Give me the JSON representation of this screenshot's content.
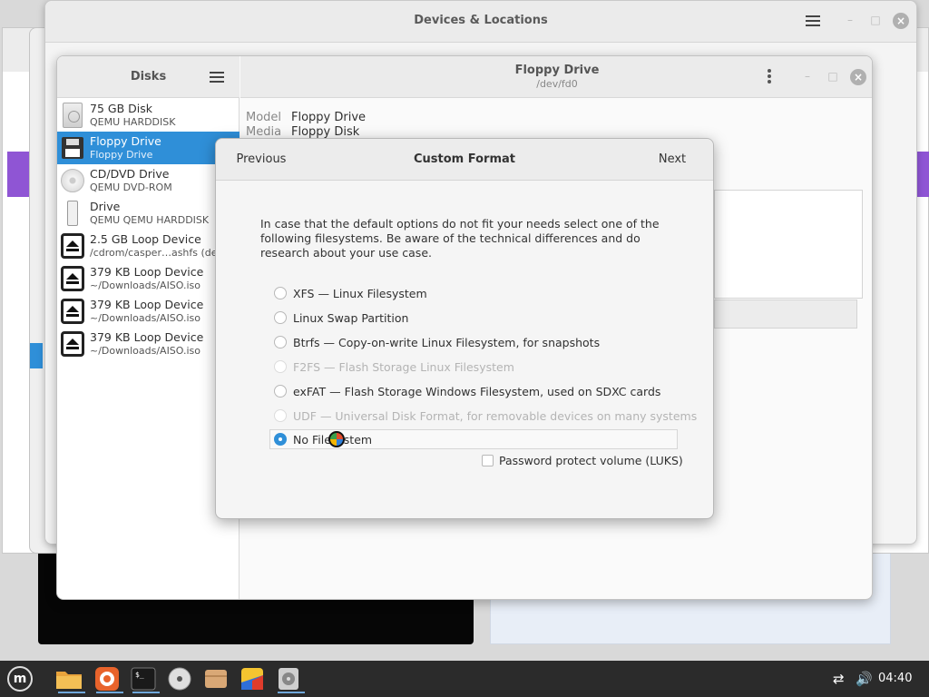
{
  "settings_window": {
    "title": "Devices & Locations"
  },
  "disks_window": {
    "sidebar_title": "Disks",
    "drive_title": "Floppy Drive",
    "drive_path": "/dev/fd0",
    "info": {
      "model_label": "Model",
      "model_value": "Floppy Drive",
      "media_label": "Media",
      "media_value": "Floppy Disk"
    },
    "disks": [
      {
        "name": "75 GB Disk",
        "sub": "QEMU HARDDISK",
        "icon": "harddisk-icon"
      },
      {
        "name": "Floppy Drive",
        "sub": "Floppy Drive",
        "icon": "floppy-icon",
        "selected": true
      },
      {
        "name": "CD/DVD Drive",
        "sub": "QEMU DVD-ROM",
        "icon": "optical-disc-icon"
      },
      {
        "name": "Drive",
        "sub": "QEMU QEMU HARDDISK",
        "icon": "usb-drive-icon"
      },
      {
        "name": "2.5 GB Loop Device",
        "sub": "/cdrom/casper…ashfs (dele",
        "icon": "eject-icon"
      },
      {
        "name": "379 KB Loop Device",
        "sub": "~/Downloads/AISO.iso",
        "icon": "eject-icon"
      },
      {
        "name": "379 KB Loop Device",
        "sub": "~/Downloads/AISO.iso",
        "icon": "eject-icon"
      },
      {
        "name": "379 KB Loop Device",
        "sub": "~/Downloads/AISO.iso",
        "icon": "eject-icon"
      }
    ]
  },
  "dialog": {
    "previous_label": "Previous",
    "title": "Custom Format",
    "next_label": "Next",
    "description": "In case that the default options do not fit your needs select one of the following filesystems. Be aware of the technical differences and do research about your use case.",
    "options": [
      {
        "label": "XFS — Linux Filesystem",
        "enabled": true,
        "checked": false
      },
      {
        "label": "Linux Swap Partition",
        "enabled": true,
        "checked": false
      },
      {
        "label": "Btrfs — Copy-on-write Linux Filesystem, for snapshots",
        "enabled": true,
        "checked": false
      },
      {
        "label": "F2FS — Flash Storage Linux Filesystem",
        "enabled": false,
        "checked": false
      },
      {
        "label": "exFAT — Flash Storage Windows Filesystem, used on SDXC cards",
        "enabled": true,
        "checked": false
      },
      {
        "label": "UDF — Universal Disk Format, for removable devices on many systems",
        "enabled": false,
        "checked": false
      },
      {
        "label": "No Filesystem",
        "enabled": true,
        "checked": true
      }
    ],
    "luks_label": "Password protect volume (LUKS)",
    "luks_checked": false
  },
  "taskbar": {
    "menu_glyph": "m",
    "apps": [
      "file-manager-icon",
      "firefox-icon",
      "terminal-icon",
      "disc-icon",
      "archive-icon",
      "drawing-icon",
      "disks-icon"
    ],
    "time": "04:40"
  },
  "colors": {
    "accent": "#2f8fd8",
    "taskbar": "#2b2b2b"
  }
}
